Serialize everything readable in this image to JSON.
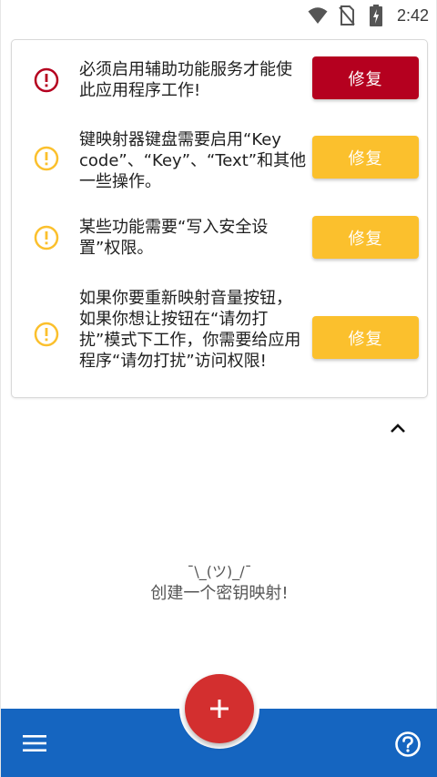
{
  "status_bar": {
    "time": "2:42",
    "icons": [
      "wifi-icon",
      "no-sim-icon",
      "battery-charging-icon"
    ]
  },
  "warnings": [
    {
      "severity": "error",
      "icon": "error-icon",
      "text": "必须启用辅助功能服务才能使此应用程序工作!",
      "button_label": "修复"
    },
    {
      "severity": "warning",
      "icon": "warning-icon",
      "text": "键映射器键盘需要启用“Key code”、“Key”、“Text”和其他一些操作。",
      "button_label": "修复"
    },
    {
      "severity": "warning",
      "icon": "warning-icon",
      "text": "某些功能需要“写入安全设置”权限。",
      "button_label": "修复"
    },
    {
      "severity": "warning",
      "icon": "warning-icon",
      "text": "如果你要重新映射音量按钮，如果你想让按钮在“请勿打扰”模式下工作，你需要给应用程序“请勿打扰”访问权限!",
      "button_label": "修复"
    }
  ],
  "collapse_icon": "chevron-up-icon",
  "empty_state": {
    "shrug": "¯\\_(ツ)_/¯",
    "message": "创建一个密钥映射!"
  },
  "bottom_bar": {
    "menu_icon": "menu-icon",
    "fab_icon": "plus-icon",
    "help_icon": "help-icon"
  },
  "colors": {
    "error": "#b5001f",
    "warning": "#fbc02d",
    "bottom_bar": "#1565c0",
    "fab": "#d32f2f"
  }
}
